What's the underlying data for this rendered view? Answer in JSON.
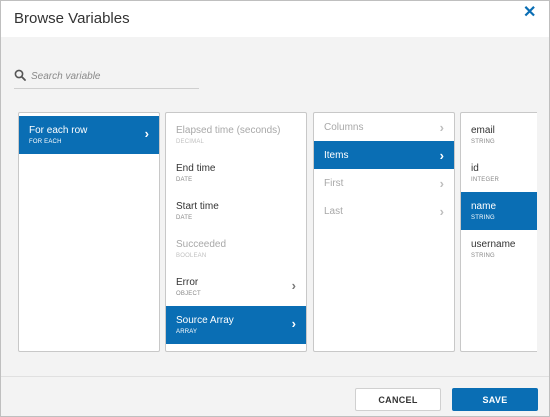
{
  "dialog": {
    "title": "Browse Variables",
    "close_icon": "close-icon"
  },
  "search": {
    "placeholder": "Search variable",
    "value": "",
    "icon": "search-icon"
  },
  "columns": [
    {
      "items": [
        {
          "label": "For each row",
          "type": "FOR EACH",
          "selected": true,
          "disabled": false,
          "has_children": true
        }
      ]
    },
    {
      "items": [
        {
          "label": "Elapsed time (seconds)",
          "type": "DECIMAL",
          "selected": false,
          "disabled": true,
          "has_children": false
        },
        {
          "label": "End time",
          "type": "DATE",
          "selected": false,
          "disabled": false,
          "has_children": false
        },
        {
          "label": "Start time",
          "type": "DATE",
          "selected": false,
          "disabled": false,
          "has_children": false
        },
        {
          "label": "Succeeded",
          "type": "BOOLEAN",
          "selected": false,
          "disabled": true,
          "has_children": false
        },
        {
          "label": "Error",
          "type": "OBJECT",
          "selected": false,
          "disabled": false,
          "has_children": true
        },
        {
          "label": "Source Array",
          "type": "ARRAY",
          "selected": true,
          "disabled": false,
          "has_children": true
        }
      ]
    },
    {
      "items": [
        {
          "label": "Columns",
          "selected": false,
          "disabled": true,
          "has_children": true
        },
        {
          "label": "Items",
          "selected": true,
          "disabled": false,
          "has_children": true
        },
        {
          "label": "First",
          "selected": false,
          "disabled": true,
          "has_children": true
        },
        {
          "label": "Last",
          "selected": false,
          "disabled": true,
          "has_children": true
        }
      ]
    },
    {
      "items": [
        {
          "label": "email",
          "type": "STRING",
          "selected": false,
          "disabled": false,
          "has_children": false
        },
        {
          "label": "id",
          "type": "INTEGER",
          "selected": false,
          "disabled": false,
          "has_children": false
        },
        {
          "label": "name",
          "type": "STRING",
          "selected": true,
          "disabled": false,
          "has_children": false
        },
        {
          "label": "username",
          "type": "STRING",
          "selected": false,
          "disabled": false,
          "has_children": false
        }
      ]
    }
  ],
  "footer": {
    "cancel_label": "CANCEL",
    "save_label": "SAVE"
  },
  "colors": {
    "accent": "#0a6eb4",
    "background": "#f3f3f3"
  }
}
